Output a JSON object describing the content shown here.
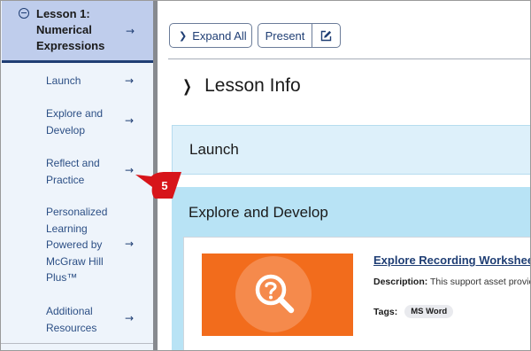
{
  "sidebar": {
    "lesson": {
      "title": "Lesson 1: Numerical Expressions",
      "arrow": "→"
    },
    "items": [
      {
        "label": "Launch",
        "arrow": "→"
      },
      {
        "label": "Explore and Develop",
        "arrow": "→"
      },
      {
        "label": "Reflect and Practice",
        "arrow": "→"
      },
      {
        "label": "Personalized Learning Powered by McGraw Hill Plus™",
        "arrow": "→"
      },
      {
        "label": "Additional Resources",
        "arrow": "→"
      }
    ]
  },
  "toolbar": {
    "expand_label": "Expand All",
    "expand_icon": "chevron-right-icon",
    "present_label": "Present",
    "edit_icon": "edit-icon"
  },
  "main": {
    "lesson_info": "Lesson Info",
    "sections": [
      {
        "label": "Launch"
      },
      {
        "label": "Explore and Develop"
      }
    ],
    "resource": {
      "title": "Explore Recording Workshee",
      "description_label": "Description:",
      "description_text": "This support asset provic",
      "tags_label": "Tags:",
      "tag": "MS Word",
      "thumb_icon": "search-question-icon"
    }
  },
  "callout": {
    "number": "5"
  },
  "colors": {
    "accent_navy": "#1f3e74",
    "lesson_header_bg": "#bfcdec",
    "sidebar_bg": "#eef4fb",
    "launch_band": "#ddf0fa",
    "explore_band": "#b8e3f5",
    "thumb_orange": "#f26c1c",
    "callout_red": "#d7141a"
  }
}
